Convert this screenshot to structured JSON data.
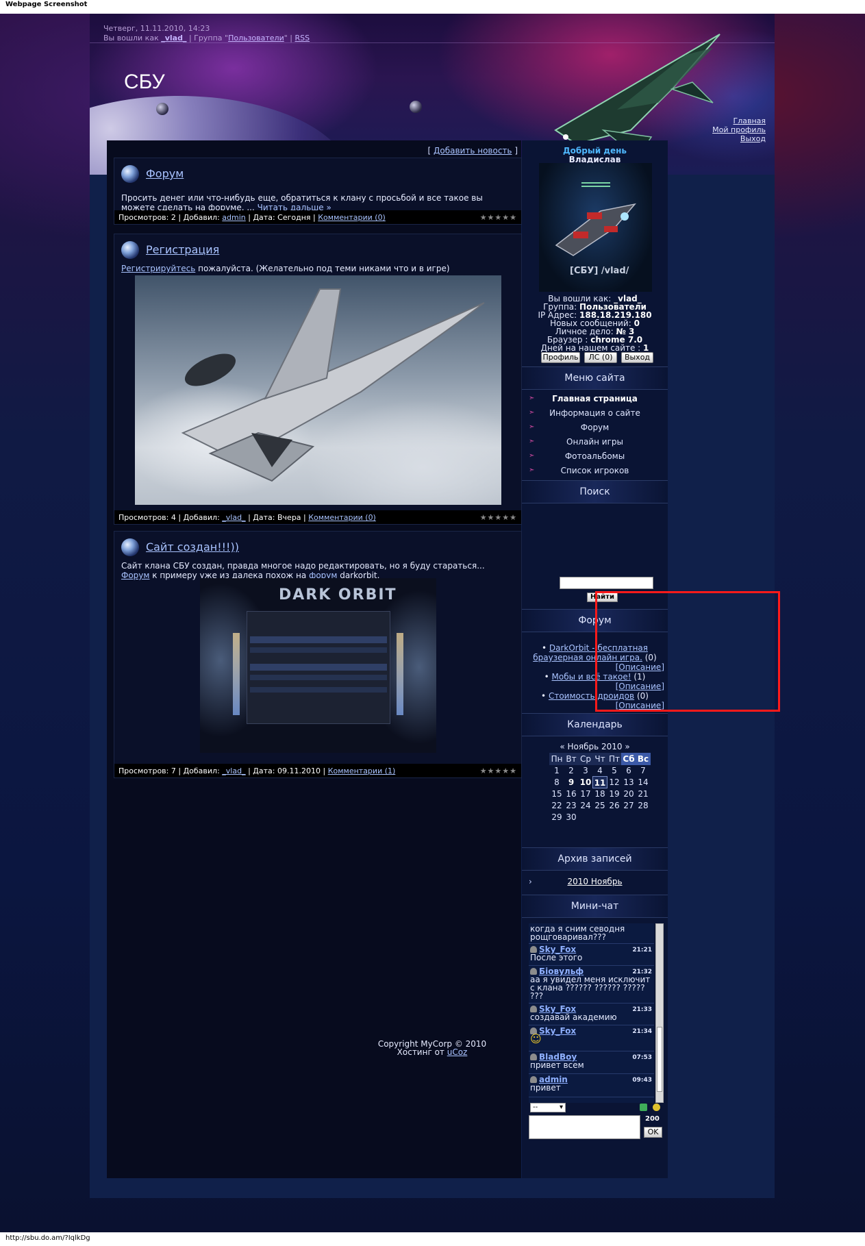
{
  "screenshot_caption": "Webpage Screenshot",
  "status_url": "http://sbu.do.am/?IqlkDg",
  "header": {
    "date": "Четверг, 11.11.2010, 14:23",
    "logged_prefix": "Вы вошли как",
    "user": "_vlad_",
    "group_prefix": "| Группа \"",
    "group": "Пользователи",
    "group_suffix": "\" |",
    "rss": "RSS",
    "site_name": "СБУ",
    "nav": [
      "Главная",
      "Мой профиль",
      "Выход"
    ]
  },
  "add_news": {
    "open": "[",
    "label": "Добавить новость",
    "close": "]"
  },
  "posts": [
    {
      "title": "Форум",
      "text": "Просить денег или что-нибудь еще, обратиться к клану с просьбой и все такое  вы можете сделать на форуме. ...",
      "read_more": "Читать дальше »",
      "footer": {
        "views_label": "Просмотров:",
        "views": "2",
        "added_label": "| Добавил:",
        "author": "admin",
        "date_label": "| Дата:",
        "date": "Сегодня",
        "comments": "Комментарии (0)"
      }
    },
    {
      "title": "Регистрация",
      "text_link": "Регистрируйтесь",
      "text": " пожалуйста. (Желательно под теми никами что и в игре)",
      "footer": {
        "views_label": "Просмотров:",
        "views": "4",
        "added_label": "| Добавил:",
        "author": "_vlad_",
        "date_label": "| Дата:",
        "date": "Вчера",
        "comments": "Комментарии (0)"
      }
    },
    {
      "title": "Сайт создан!!!))",
      "text_a": "Сайт клана СБУ создан, правда многое надо редактировать, но я буду стараться... ",
      "link_a": "Форум",
      "text_b": " к примеру уже из далека похож на ",
      "link_b": "форум",
      "text_c": " darkorbit.",
      "image_logo": "DARK ORBIT",
      "footer": {
        "views_label": "Просмотров:",
        "views": "7",
        "added_label": "| Добавил:",
        "author": "_vlad_",
        "date_label": "| Дата:",
        "date": "09.11.2010",
        "comments": "Комментарии (1)"
      }
    }
  ],
  "stars": "★★★★★",
  "user_panel": {
    "greeting": "Добрый день",
    "name": "Владислав",
    "avatar_tag": "[СБУ] /vlad/",
    "rows": [
      {
        "label": "Вы вошли как:",
        "value": "_vlad_"
      },
      {
        "label": "Группа:",
        "value": "Пользователи"
      },
      {
        "label": "IP Адрес:",
        "value": "188.18.219.180"
      },
      {
        "label": "Новых сообщений:",
        "value": "0"
      },
      {
        "label": "Личное дело:",
        "value": "№ 3"
      },
      {
        "label": "Браузер :",
        "value": "chrome 7.0"
      },
      {
        "label": "Дней на нашем сайте :",
        "value": "1"
      }
    ],
    "buttons": [
      "Профиль",
      "ЛС (0)",
      "Выход"
    ]
  },
  "menu": {
    "title": "Меню сайта",
    "items": [
      "Главная страница",
      "Информация о сайте",
      "Форум",
      "Онлайн игры",
      "Фотоальбомы",
      "Список игроков"
    ]
  },
  "search": {
    "title": "Поиск",
    "button": "Найти"
  },
  "forum": {
    "title": "Форум",
    "items": [
      {
        "line1": "DarkOrbit - бесплатная",
        "line2": "браузерная онлайн игра.",
        "count": "(0)",
        "descr": "[Описание]"
      },
      {
        "line1": "Мобы и всё такое!",
        "count": "(1)",
        "descr": "[Описание]"
      },
      {
        "line1": "Стоимость дроидов",
        "count": "(0)",
        "descr": "[Описание]"
      }
    ]
  },
  "calendar": {
    "title": "Календарь",
    "prev": "«",
    "month": "Ноябрь 2010",
    "next": "»",
    "days": [
      "Пн",
      "Вт",
      "Ср",
      "Чт",
      "Пт",
      "Сб",
      "Вс"
    ],
    "weeks": [
      [
        "1",
        "2",
        "3",
        "4",
        "5",
        "6",
        "7"
      ],
      [
        "8",
        "9",
        "10",
        "11",
        "12",
        "13",
        "14"
      ],
      [
        "15",
        "16",
        "17",
        "18",
        "19",
        "20",
        "21"
      ],
      [
        "22",
        "23",
        "24",
        "25",
        "26",
        "27",
        "28"
      ],
      [
        "29",
        "30",
        "",
        "",
        "",
        "",
        ""
      ]
    ],
    "bold": [
      "9",
      "10",
      "11"
    ],
    "today": "11"
  },
  "archive": {
    "title": "Архив записей",
    "bullet": "›",
    "item": "2010 Ноябрь"
  },
  "chat": {
    "title": "Мини-чат",
    "messages": [
      {
        "user": "",
        "time": "",
        "text": "когда я сним севодня рощговаривал???"
      },
      {
        "user": "Sky_Fox",
        "time": "21:21",
        "text": "После этого"
      },
      {
        "user": "Біовульф",
        "time": "21:32",
        "text": "аа я увидел меня исключит с клана ?????? ?????? ????? ???"
      },
      {
        "user": "Sky_Fox",
        "time": "21:33",
        "text": "создавай академию"
      },
      {
        "user": "Sky_Fox",
        "time": "21:34",
        "text": "☺"
      },
      {
        "user": "BladBoy",
        "time": "07:53",
        "text": "привет всем"
      },
      {
        "user": "admin",
        "time": "09:43",
        "text": "привет"
      }
    ],
    "select_value": "--",
    "count": "200",
    "ok": "OK"
  },
  "footer": {
    "copyright": "Copyright MyCorp © 2010",
    "hosting_prefix": "Хостинг от ",
    "hosting_link": "uCoz"
  }
}
